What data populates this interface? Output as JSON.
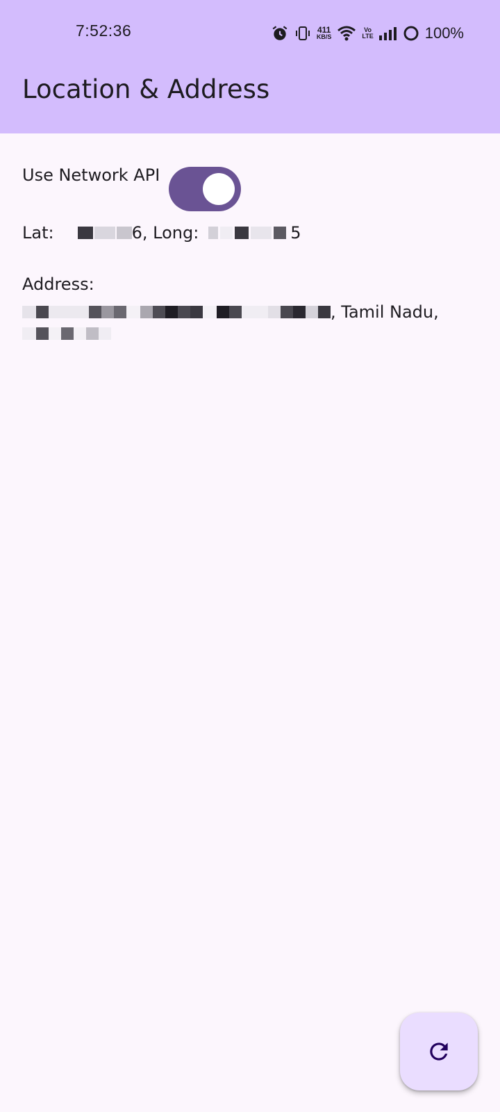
{
  "status_bar": {
    "time": "7:52:36",
    "net_speed_value": "411",
    "net_speed_unit": "KB/S",
    "volte_top": "Vo",
    "volte_bottom": "LTE",
    "battery": "100%",
    "icons": [
      "alarm-icon",
      "vibrate-icon",
      "wifi-icon",
      "signal-icon",
      "battery-icon"
    ]
  },
  "app_bar": {
    "title": "Location & Address"
  },
  "controls": {
    "network_api_label": "Use Network API",
    "network_api_enabled": true
  },
  "location": {
    "lat_label": "Lat:",
    "lat_value_suffix": "6",
    "long_label": ", Long:",
    "long_value_suffix": "5"
  },
  "address": {
    "label": "Address:",
    "line1_visible": ", Tamil Nadu,"
  },
  "fab": {
    "icon": "refresh-icon"
  },
  "colors": {
    "app_bar": "#d3bcfd",
    "background": "#fcf6fd",
    "switch_track": "#6a5394",
    "fab": "#eaddff"
  }
}
